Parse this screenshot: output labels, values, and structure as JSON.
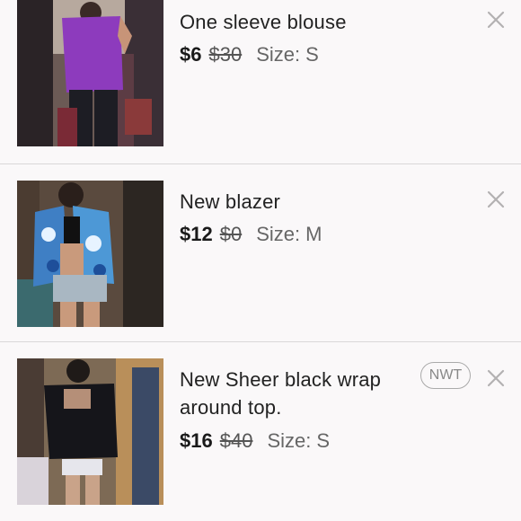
{
  "listings": [
    {
      "title": "One sleeve blouse",
      "price": "$6",
      "original_price": "$30",
      "size_label": "Size:",
      "size": "S",
      "badge": "",
      "thumb_icon": "purple-top-photo",
      "remove_icon": "close-icon"
    },
    {
      "title": "New blazer",
      "price": "$12",
      "original_price": "$0",
      "size_label": "Size:",
      "size": "M",
      "badge": "",
      "thumb_icon": "printed-blazer-photo",
      "remove_icon": "close-icon"
    },
    {
      "title": "New Sheer black wrap around top.",
      "price": "$16",
      "original_price": "$40",
      "size_label": "Size:",
      "size": "S",
      "badge": "NWT",
      "thumb_icon": "black-wrap-top-photo",
      "remove_icon": "close-icon"
    }
  ],
  "colors": {
    "background": "#faf8f9",
    "divider": "#d9d7d8",
    "close_icon": "#b3b1b2",
    "badge_border": "#aaaaaa"
  }
}
